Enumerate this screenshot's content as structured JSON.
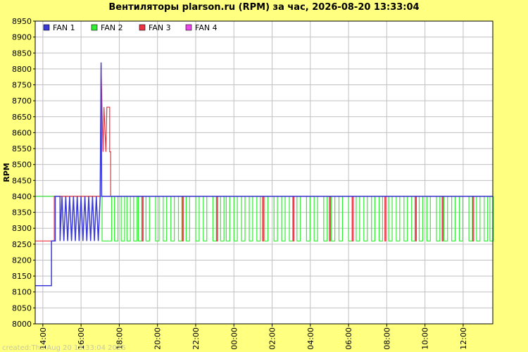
{
  "chart_data": {
    "type": "line",
    "title": "Вентиляторы plarson.ru (RPM) за час, 2026-08-20 13:33:04",
    "ylabel": "RPM",
    "xlabel": "",
    "ylim": [
      8000,
      8950
    ],
    "yticks": [
      8000,
      8050,
      8100,
      8150,
      8200,
      8250,
      8300,
      8350,
      8400,
      8450,
      8500,
      8550,
      8600,
      8650,
      8700,
      8750,
      8800,
      8850,
      8900,
      8950
    ],
    "xticks": [
      "14:00",
      "16:00",
      "18:00",
      "20:00",
      "22:00",
      "00:00",
      "02:00",
      "04:00",
      "06:00",
      "08:00",
      "10:00",
      "12:00"
    ],
    "xrange_hours": [
      13.6,
      37.55
    ],
    "grid": true,
    "legend_position": "top-left",
    "footer": "created:Thu Aug 20 13:33:04 2026",
    "colors": {
      "background": "#ffff80",
      "plot": "#ffffff",
      "grid": "#c0c0c0"
    },
    "series": [
      {
        "name": "FAN 1",
        "color": "#3a3ad8",
        "segments": [
          [
            13.6,
            8120
          ],
          [
            14.45,
            8120
          ],
          [
            14.45,
            8260
          ],
          [
            14.65,
            8260
          ],
          [
            14.65,
            8400
          ],
          [
            14.9,
            8400
          ],
          [
            14.9,
            8260
          ],
          [
            15.0,
            8400
          ],
          [
            15.1,
            8260
          ],
          [
            15.2,
            8400
          ],
          [
            15.3,
            8260
          ],
          [
            15.4,
            8400
          ],
          [
            15.5,
            8260
          ],
          [
            15.6,
            8400
          ],
          [
            15.7,
            8260
          ],
          [
            15.8,
            8400
          ],
          [
            15.9,
            8260
          ],
          [
            16.0,
            8400
          ],
          [
            16.1,
            8260
          ],
          [
            16.2,
            8400
          ],
          [
            16.3,
            8260
          ],
          [
            16.4,
            8400
          ],
          [
            16.5,
            8260
          ],
          [
            16.6,
            8400
          ],
          [
            16.7,
            8260
          ],
          [
            16.8,
            8400
          ],
          [
            16.9,
            8260
          ],
          [
            17.0,
            8400
          ],
          [
            17.05,
            8820
          ],
          [
            17.08,
            8400
          ],
          [
            37.55,
            8400
          ]
        ]
      },
      {
        "name": "FAN 2",
        "color": "#33ee33",
        "base": 8400,
        "low": 8260,
        "pre": [
          [
            13.6,
            8400
          ],
          [
            17.1,
            8400
          ],
          [
            17.1,
            8260
          ],
          [
            17.6,
            8260
          ],
          [
            17.6,
            8400
          ]
        ],
        "pulses_hours": [
          17.75,
          18.1,
          18.4,
          18.75,
          19.0,
          19.4,
          19.9,
          20.3,
          20.7,
          21.1,
          21.5,
          22.0,
          22.4,
          22.9,
          23.3,
          23.6,
          24.0,
          24.4,
          24.8,
          25.2,
          25.6,
          26.1,
          26.5,
          26.9,
          27.3,
          27.8,
          28.2,
          28.7,
          29.1,
          29.5,
          30.0,
          30.4,
          30.8,
          31.2,
          31.6,
          32.1,
          32.5,
          32.9,
          33.3,
          33.7,
          34.1,
          34.6,
          35.0,
          35.4,
          35.8,
          36.3,
          36.7,
          37.1,
          37.4
        ]
      },
      {
        "name": "FAN 3",
        "color": "#ee3344",
        "pre": [
          [
            13.6,
            8260
          ],
          [
            14.6,
            8260
          ],
          [
            14.6,
            8400
          ],
          [
            17.0,
            8400
          ],
          [
            17.05,
            8810
          ],
          [
            17.15,
            8540
          ],
          [
            17.2,
            8680
          ],
          [
            17.3,
            8540
          ],
          [
            17.35,
            8680
          ],
          [
            17.5,
            8680
          ],
          [
            17.5,
            8540
          ],
          [
            17.55,
            8540
          ],
          [
            17.55,
            8400
          ],
          [
            37.55,
            8400
          ]
        ],
        "pulses_hours": [
          19.2,
          21.3,
          23.1,
          25.5,
          27.1,
          29.0,
          30.2,
          31.9,
          33.5,
          34.9,
          36.5
        ]
      },
      {
        "name": "FAN 4",
        "color": "#ee44ee",
        "pre": [
          [
            13.6,
            8400
          ],
          [
            37.55,
            8400
          ]
        ]
      }
    ]
  }
}
